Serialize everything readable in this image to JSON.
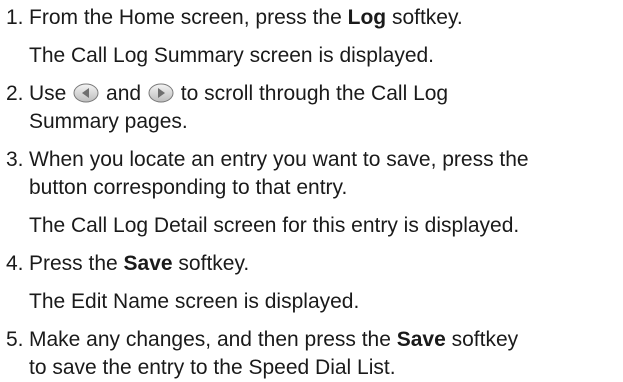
{
  "steps": [
    {
      "number": "1.",
      "pre": "From the Home screen, press the ",
      "bold": "Log",
      "post": " softkey.",
      "result": "The Call Log Summary screen is displayed."
    },
    {
      "number": "2.",
      "use": "Use",
      "and": "and",
      "post_line1": "to scroll through the Call Log",
      "line2": "Summary pages.",
      "left_icon": "left-arrow-button-icon",
      "right_icon": "right-arrow-button-icon"
    },
    {
      "number": "3.",
      "line1": "When you locate an entry you want to save, press the",
      "line2": "button corresponding to that entry.",
      "result": "The Call Log Detail screen for this entry is displayed."
    },
    {
      "number": "4.",
      "pre": "Press the ",
      "bold": "Save",
      "post": " softkey.",
      "result": "The Edit Name screen is displayed."
    },
    {
      "number": "5.",
      "pre": "Make any changes, and then press the ",
      "bold": "Save",
      "post": " softkey",
      "line2": "to save the entry to the Speed Dial List."
    }
  ]
}
